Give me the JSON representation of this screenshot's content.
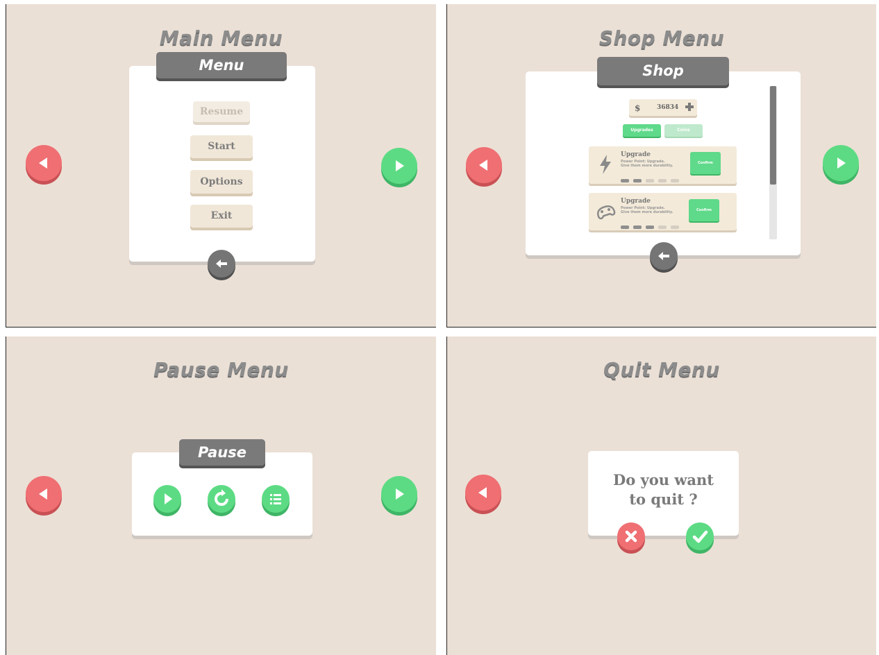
{
  "main_menu": {
    "title": "Main Menu",
    "header": "Menu",
    "buttons": {
      "resume": "Resume",
      "start": "Start",
      "options": "Options",
      "exit": "Exit"
    }
  },
  "shop_menu": {
    "title": "Shop Menu",
    "header": "Shop",
    "currency_symbol": "$",
    "currency_amount": "36834",
    "tabs": {
      "upgrades": "Upgrades",
      "coins": "Coins"
    },
    "items": [
      {
        "title": "Upgrade",
        "desc1": "Power Point: Upgrade.",
        "desc2": "Give them more durability.",
        "confirm": "Confirm",
        "level": 2,
        "max_level": 5,
        "icon": "lightning-icon"
      },
      {
        "title": "Upgrade",
        "desc1": "Power Point: Upgrade.",
        "desc2": "Give them more durability.",
        "confirm": "Confirm",
        "level": 3,
        "max_level": 5,
        "icon": "gamepad-icon"
      }
    ]
  },
  "pause_menu": {
    "title": "Pause Menu",
    "header": "Pause"
  },
  "quit_menu": {
    "title": "Quit Menu",
    "question_line1": "Do you want",
    "question_line2": "to quit ?"
  },
  "colors": {
    "background": "#ebe0d6",
    "red": "#ef6f73",
    "green": "#5ddb84",
    "gray": "#7a7a7a",
    "card": "#ffffff",
    "button": "#f1e7d8"
  },
  "icons": {
    "prev": "arrow-left-icon",
    "next": "arrow-right-icon",
    "back": "back-arrow-icon",
    "play": "play-icon",
    "restart": "restart-icon",
    "menu": "list-icon",
    "cancel": "close-icon",
    "confirm": "check-icon",
    "add": "plus-icon"
  }
}
